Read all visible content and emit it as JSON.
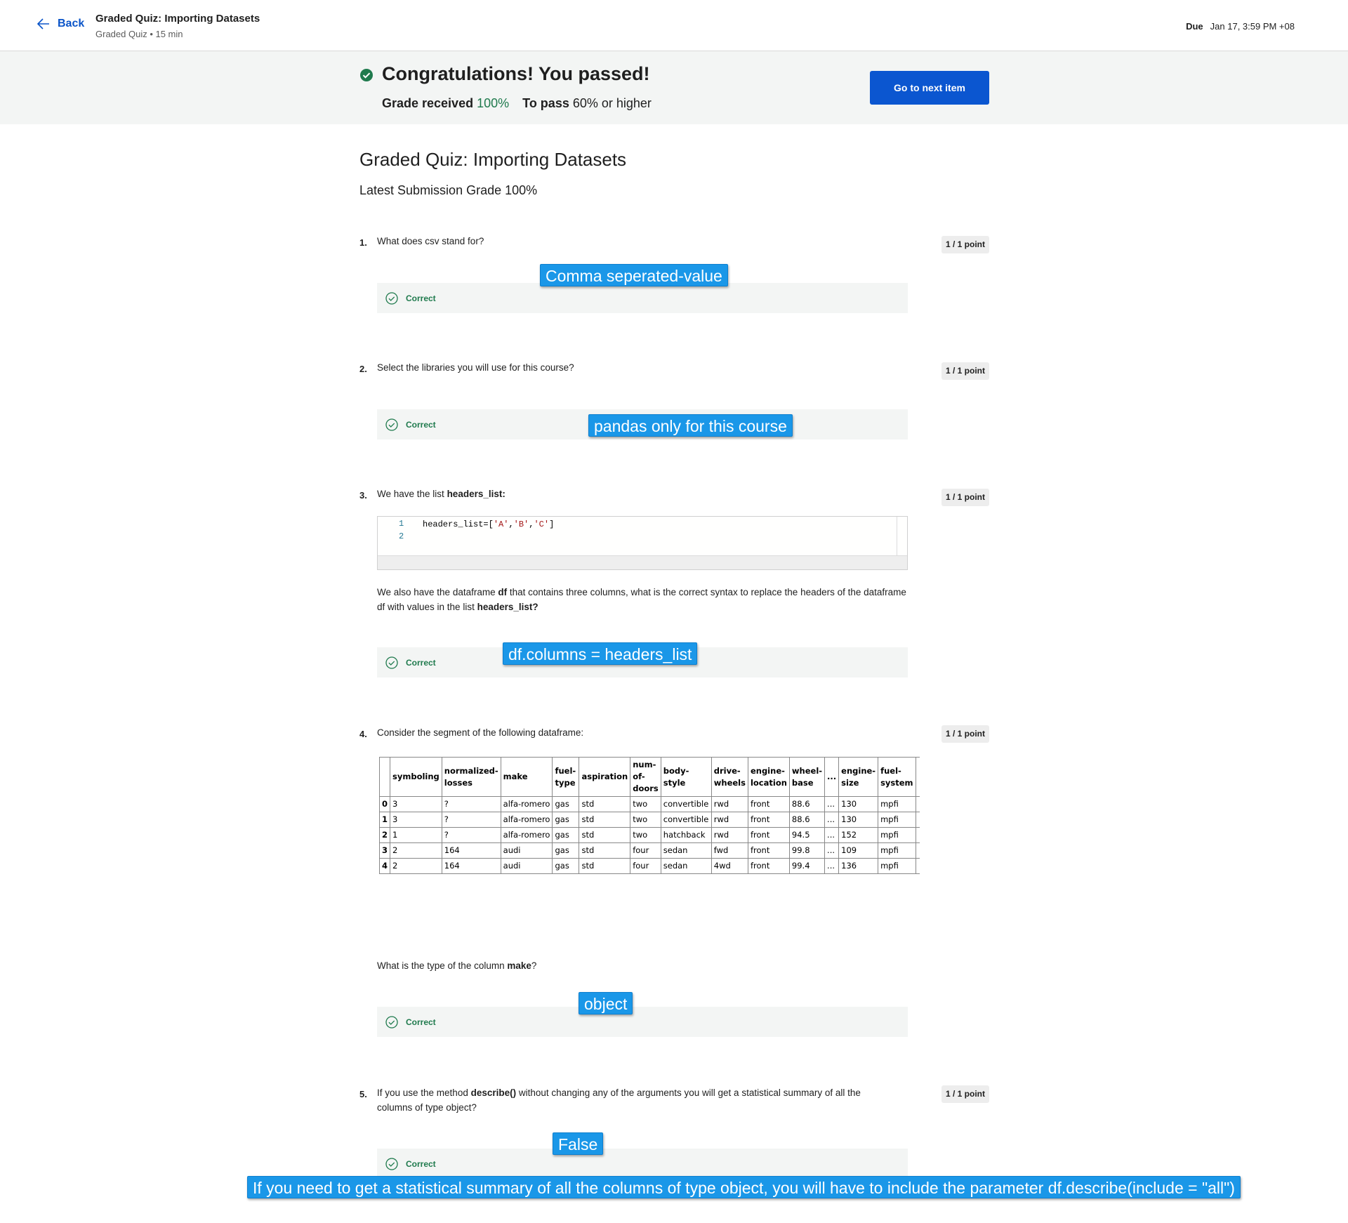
{
  "header": {
    "back_label": "Back",
    "title": "Graded Quiz: Importing Datasets",
    "subtitle": "Graded Quiz • 15 min",
    "due_label": "Due",
    "due_value": "Jan 17, 3:59 PM +08"
  },
  "banner": {
    "title": "Congratulations! You passed!",
    "grade_label": "Grade received",
    "grade_value": "100%",
    "pass_label": "To pass",
    "pass_value": "60% or higher",
    "next_button": "Go to next item"
  },
  "quiz": {
    "title": "Graded Quiz: Importing Datasets",
    "latest_grade": "Latest Submission Grade 100%"
  },
  "questions": [
    {
      "number": "1.",
      "text": "What does csv stand for?",
      "points": "1 / 1 point",
      "status": "Correct",
      "annotation": "Comma seperated-value"
    },
    {
      "number": "2.",
      "text": "Select the libraries you will use for this course?",
      "points": "1 / 1 point",
      "status": "Correct",
      "annotation": "pandas only for this course"
    },
    {
      "number": "3.",
      "text_pre": "We have the list ",
      "text_bold": "headers_list:",
      "points": "1 / 1 point",
      "code_lines": [
        "1",
        "2"
      ],
      "code_pre": "headers_list=[",
      "code_a": "'A'",
      "code_sep1": ",",
      "code_b": "'B'",
      "code_sep2": ",",
      "code_c": "'C'",
      "code_post": "]",
      "desc_1": "We also have the dataframe ",
      "desc_bold1": "df",
      "desc_2": " that contains three columns, what is the correct syntax to replace the headers of the dataframe df with values in the list ",
      "desc_bold2": "headers_list?",
      "status": "Correct",
      "annotation": "df.columns = headers_list"
    },
    {
      "number": "4.",
      "text": "Consider the segment of the following dataframe:",
      "points": "1 / 1 point",
      "follow_pre": "What is the type of the column ",
      "follow_bold": "make",
      "follow_post": "?",
      "status": "Correct",
      "annotation": "object"
    },
    {
      "number": "5.",
      "text_pre": "If you use the method  ",
      "text_bold": "describe()",
      "text_post": " without changing any of the arguments you will get a statistical summary of all the columns of type object?",
      "points": "1 / 1 point",
      "status": "Correct",
      "annotation": "False",
      "note": "If you need to get a statistical summary of all the columns of type object, you will have to include the parameter df.describe(include = \"all\")"
    }
  ],
  "dataframe": {
    "headers": [
      "",
      "symboling",
      "normalized-losses",
      "make",
      "fuel-type",
      "aspiration",
      "num-of-doors",
      "body-style",
      "drive-wheels",
      "engine-location",
      "wheel-base",
      "...",
      "engine-size",
      "fuel-system"
    ],
    "rows": [
      [
        "0",
        "3",
        "?",
        "alfa-romero",
        "gas",
        "std",
        "two",
        "convertible",
        "rwd",
        "front",
        "88.6",
        "...",
        "130",
        "mpfi"
      ],
      [
        "1",
        "3",
        "?",
        "alfa-romero",
        "gas",
        "std",
        "two",
        "convertible",
        "rwd",
        "front",
        "88.6",
        "...",
        "130",
        "mpfi"
      ],
      [
        "2",
        "1",
        "?",
        "alfa-romero",
        "gas",
        "std",
        "two",
        "hatchback",
        "rwd",
        "front",
        "94.5",
        "...",
        "152",
        "mpfi"
      ],
      [
        "3",
        "2",
        "164",
        "audi",
        "gas",
        "std",
        "four",
        "sedan",
        "fwd",
        "front",
        "99.8",
        "...",
        "109",
        "mpfi"
      ],
      [
        "4",
        "2",
        "164",
        "audi",
        "gas",
        "std",
        "four",
        "sedan",
        "4wd",
        "front",
        "99.4",
        "...",
        "136",
        "mpfi"
      ]
    ]
  },
  "colors": {
    "accent": "#0b56d0",
    "success": "#1f7a4d",
    "annotation": "#1a97e8"
  },
  "icons": {
    "back": "arrow-left-icon",
    "passed": "check-circle-filled-icon",
    "correct": "check-circle-outline-icon"
  }
}
